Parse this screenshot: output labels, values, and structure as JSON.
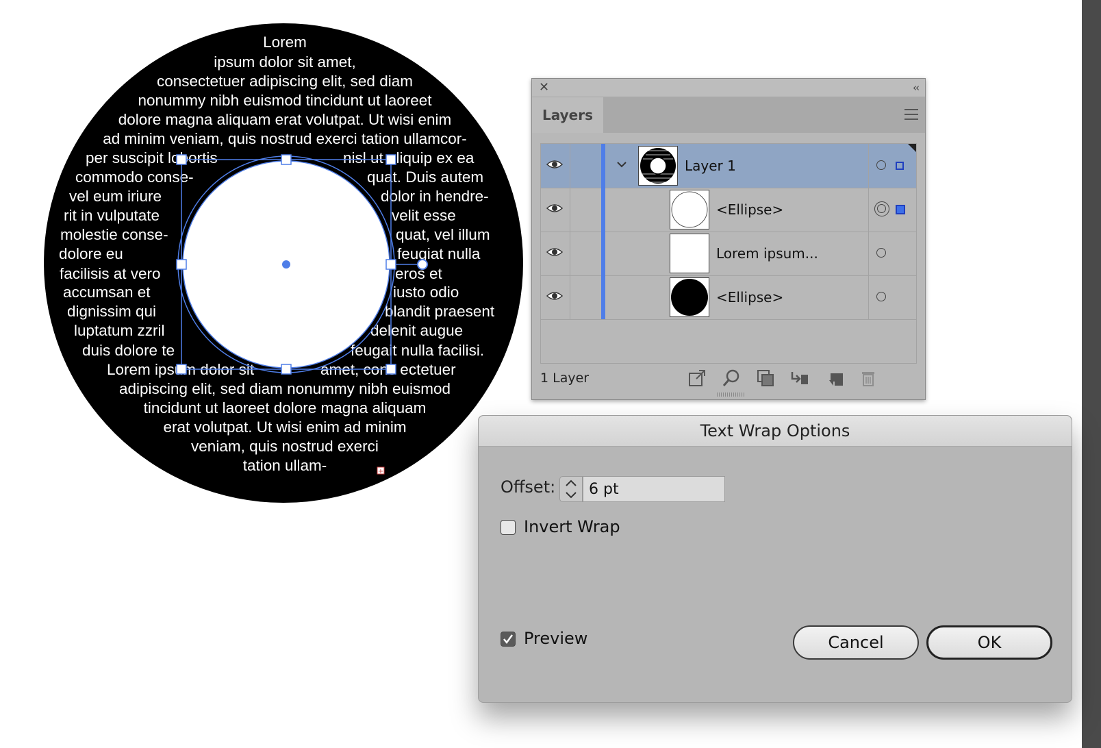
{
  "canvas": {
    "wrapped_text_lines": [
      "Lorem",
      "ipsum dolor sit amet,",
      "consectetuer adipiscing elit, sed diam",
      "nonummy nibh euismod tincidunt ut laoreet",
      "dolore magna aliquam erat volutpat. Ut wisi enim",
      "ad minim veniam, quis nostrud exerci tation ullamcor-"
    ],
    "wrapped_text_left": [
      "per suscipit lobortis",
      "commodo conse-",
      "vel eum iriure",
      "rit in vulputate",
      "molestie conse-",
      "dolore eu",
      "facilisis at vero",
      "accumsan et",
      "dignissim qui",
      "luptatum zzril",
      "duis dolore te"
    ],
    "wrapped_text_right": [
      "nisl ut aliquip ex ea",
      "quat. Duis autem",
      "dolor in hendre-",
      "velit esse",
      "quat, vel illum",
      "feugiat nulla",
      "eros et",
      "iusto odio",
      "blandit praesent",
      "delenit augue",
      "feugait nulla facilisi."
    ],
    "wrapped_text_bottom": [
      "adipiscing elit, sed diam nonummy nibh euismod",
      "tincidunt ut laoreet dolore magna aliquam",
      "erat volutpat. Ut wisi enim ad minim",
      "veniam, quis nostrud exerci",
      "tation ullam-"
    ],
    "split_line_left": "Lorem ipsum dolor sit",
    "split_line_right": "amet, cons ectetuer",
    "colors": {
      "selection": "#4f7ee8",
      "disc": "#000000",
      "text": "#ffffff"
    }
  },
  "layers_panel": {
    "close_glyph": "✕",
    "collapse_glyph": "‹‹",
    "tab_label": "Layers",
    "menu_icon": "hamburger-icon",
    "rows": [
      {
        "label": "Layer 1",
        "thumbnail": "ring-with-text",
        "selected": true,
        "expanded": true
      },
      {
        "label": "<Ellipse>",
        "thumbnail": "white-circle",
        "selected": false
      },
      {
        "label": "Lorem ipsum...",
        "thumbnail": "blank",
        "selected": false
      },
      {
        "label": "<Ellipse>",
        "thumbnail": "black-circle",
        "selected": false
      }
    ],
    "footer": {
      "count": "1 Layer",
      "icons": [
        "export-icon",
        "locate-object-icon",
        "clipping-mask-icon",
        "new-sublayer-icon",
        "new-layer-icon",
        "delete-icon"
      ]
    },
    "colors": {
      "selected_row": "#8fa5c4",
      "layer_color": "#4f7ee8"
    }
  },
  "dialog": {
    "title": "Text Wrap Options",
    "offset_label": "Offset:",
    "offset_value": "6 pt",
    "invert_wrap_label": "Invert Wrap",
    "invert_wrap_checked": false,
    "preview_label": "Preview",
    "preview_checked": true,
    "cancel_label": "Cancel",
    "ok_label": "OK"
  }
}
